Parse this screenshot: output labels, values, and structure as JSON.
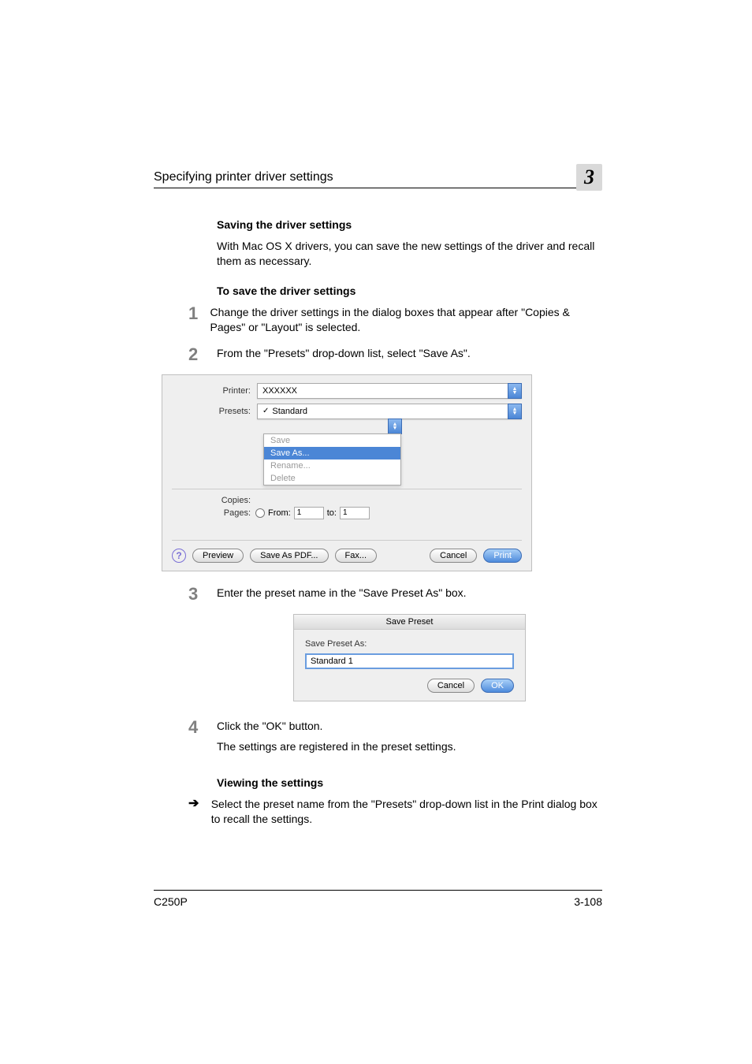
{
  "header": {
    "title": "Specifying printer driver settings",
    "chapter": "3"
  },
  "sections": {
    "h1": "Saving the driver settings",
    "p1": "With Mac OS X drivers, you can save the new settings of the driver and recall them as necessary.",
    "h2": "To save the driver settings",
    "step1": "Change the driver settings in the dialog boxes that appear after \"Copies & Pages\" or \"Layout\" is selected.",
    "step2": "From the \"Presets\" drop-down list, select \"Save As\".",
    "step3": "Enter the preset name in the \"Save Preset As\" box.",
    "step4_a": "Click the \"OK\" button.",
    "step4_b": "The settings are registered in the preset settings.",
    "h3": "Viewing the settings",
    "view_text": "Select the preset name from the \"Presets\" drop-down list in the Print dialog box to recall the settings."
  },
  "dialog1": {
    "labels": {
      "printer": "Printer:",
      "presets": "Presets:",
      "copies": "Copies:",
      "pages": "Pages:",
      "from": "From:",
      "to": "to:"
    },
    "printer_value": "XXXXXX",
    "presets_value": "Standard",
    "menu": {
      "save": "Save",
      "save_as": "Save As...",
      "rename": "Rename...",
      "delete": "Delete"
    },
    "from_val": "1",
    "to_val": "1",
    "buttons": {
      "preview": "Preview",
      "save_pdf": "Save As PDF...",
      "fax": "Fax...",
      "cancel": "Cancel",
      "print": "Print"
    }
  },
  "dialog2": {
    "title": "Save Preset",
    "label": "Save Preset As:",
    "value": "Standard 1",
    "cancel": "Cancel",
    "ok": "OK"
  },
  "footer": {
    "left": "C250P",
    "right": "3-108"
  }
}
